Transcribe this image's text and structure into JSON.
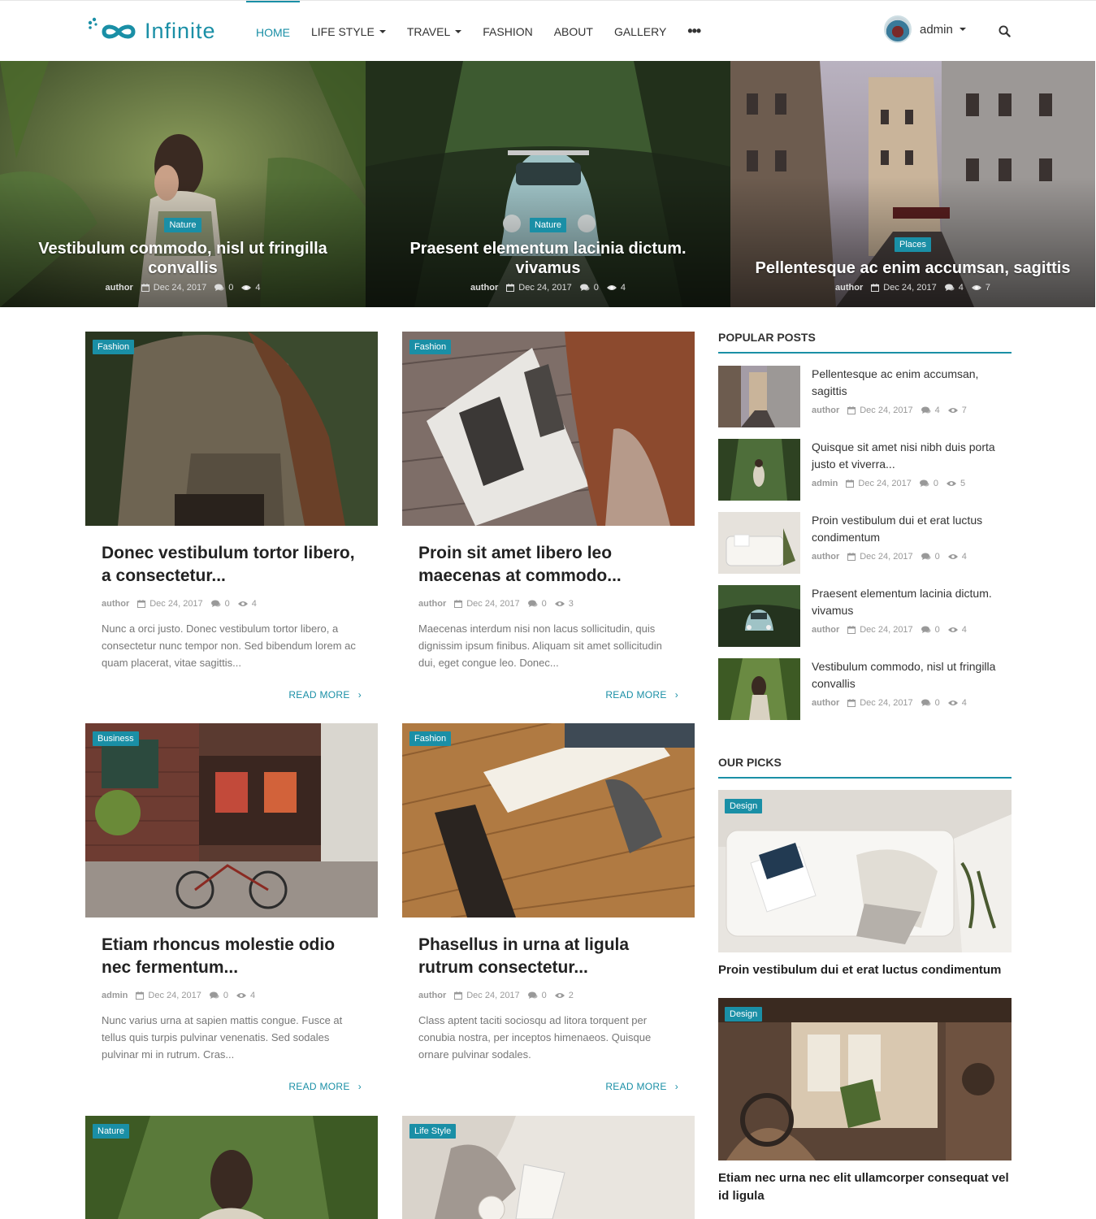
{
  "brand": {
    "name": "Infinite",
    "accent": "#1a8fa6"
  },
  "nav": {
    "items": [
      {
        "label": "HOME",
        "active": true,
        "dropdown": false
      },
      {
        "label": "LIFE STYLE",
        "active": false,
        "dropdown": true
      },
      {
        "label": "TRAVEL",
        "active": false,
        "dropdown": true
      },
      {
        "label": "FASHION",
        "active": false,
        "dropdown": false
      },
      {
        "label": "ABOUT",
        "active": false,
        "dropdown": false
      },
      {
        "label": "GALLERY",
        "active": false,
        "dropdown": false
      }
    ],
    "more_icon": "ellipsis-icon"
  },
  "user": {
    "name": "admin"
  },
  "hero": [
    {
      "category": "Nature",
      "title": "Vestibulum commodo, nisl ut fringilla convallis",
      "author": "author",
      "date": "Dec 24, 2017",
      "comments": "0",
      "views": "4"
    },
    {
      "category": "Nature",
      "title": "Praesent elementum lacinia dictum. vivamus",
      "author": "author",
      "date": "Dec 24, 2017",
      "comments": "0",
      "views": "4"
    },
    {
      "category": "Places",
      "title": "Pellentesque ac enim accumsan, sagittis",
      "author": "author",
      "date": "Dec 24, 2017",
      "comments": "4",
      "views": "7"
    }
  ],
  "posts": [
    {
      "category": "Fashion",
      "title": "Donec vestibulum tortor libero, a consectetur...",
      "author": "author",
      "date": "Dec 24, 2017",
      "comments": "0",
      "views": "4",
      "excerpt": "Nunc a orci justo. Donec vestibulum tortor libero, a consectetur nunc tempor non. Sed bibendum lorem ac quam placerat, vitae sagittis...",
      "read_more": "READ MORE"
    },
    {
      "category": "Fashion",
      "title": "Proin sit amet libero leo maecenas at commodo...",
      "author": "author",
      "date": "Dec 24, 2017",
      "comments": "0",
      "views": "3",
      "excerpt": "Maecenas interdum nisi non lacus sollicitudin, quis dignissim ipsum finibus. Aliquam sit amet sollicitudin dui, eget congue leo. Donec...",
      "read_more": "READ MORE"
    },
    {
      "category": "Business",
      "title": "Etiam rhoncus molestie odio nec fermentum...",
      "author": "admin",
      "date": "Dec 24, 2017",
      "comments": "0",
      "views": "4",
      "excerpt": "Nunc varius urna at sapien mattis congue. Fusce at tellus quis turpis pulvinar venenatis. Sed sodales pulvinar mi in rutrum. Cras...",
      "read_more": "READ MORE"
    },
    {
      "category": "Fashion",
      "title": "Phasellus in urna at ligula rutrum consectetur...",
      "author": "author",
      "date": "Dec 24, 2017",
      "comments": "0",
      "views": "2",
      "excerpt": "Class aptent taciti sociosqu ad litora torquent per conubia nostra, per inceptos himenaeos. Quisque ornare pulvinar sodales.",
      "read_more": "READ MORE"
    },
    {
      "category": "Nature"
    },
    {
      "category": "Life Style"
    }
  ],
  "popular": {
    "title": "POPULAR POSTS",
    "items": [
      {
        "title": "Pellentesque ac enim accumsan, sagittis",
        "author": "author",
        "date": "Dec 24, 2017",
        "comments": "4",
        "views": "7"
      },
      {
        "title": "Quisque sit amet nisi nibh duis porta justo et viverra...",
        "author": "admin",
        "date": "Dec 24, 2017",
        "comments": "0",
        "views": "5"
      },
      {
        "title": "Proin vestibulum dui et erat luctus condimentum",
        "author": "author",
        "date": "Dec 24, 2017",
        "comments": "0",
        "views": "4"
      },
      {
        "title": "Praesent elementum lacinia dictum. vivamus",
        "author": "author",
        "date": "Dec 24, 2017",
        "comments": "0",
        "views": "4"
      },
      {
        "title": "Vestibulum commodo, nisl ut fringilla convallis",
        "author": "author",
        "date": "Dec 24, 2017",
        "comments": "0",
        "views": "4"
      }
    ]
  },
  "picks": {
    "title": "OUR PICKS",
    "items": [
      {
        "category": "Design",
        "title": "Proin vestibulum dui et erat luctus condimentum"
      },
      {
        "category": "Design",
        "title": "Etiam nec urna nec elit ullamcorper consequat vel id ligula"
      }
    ]
  },
  "icons": {
    "date": "calendar-icon",
    "comments": "comments-icon",
    "views": "eye-icon",
    "search": "search-icon",
    "user_avatar": "avatar"
  }
}
